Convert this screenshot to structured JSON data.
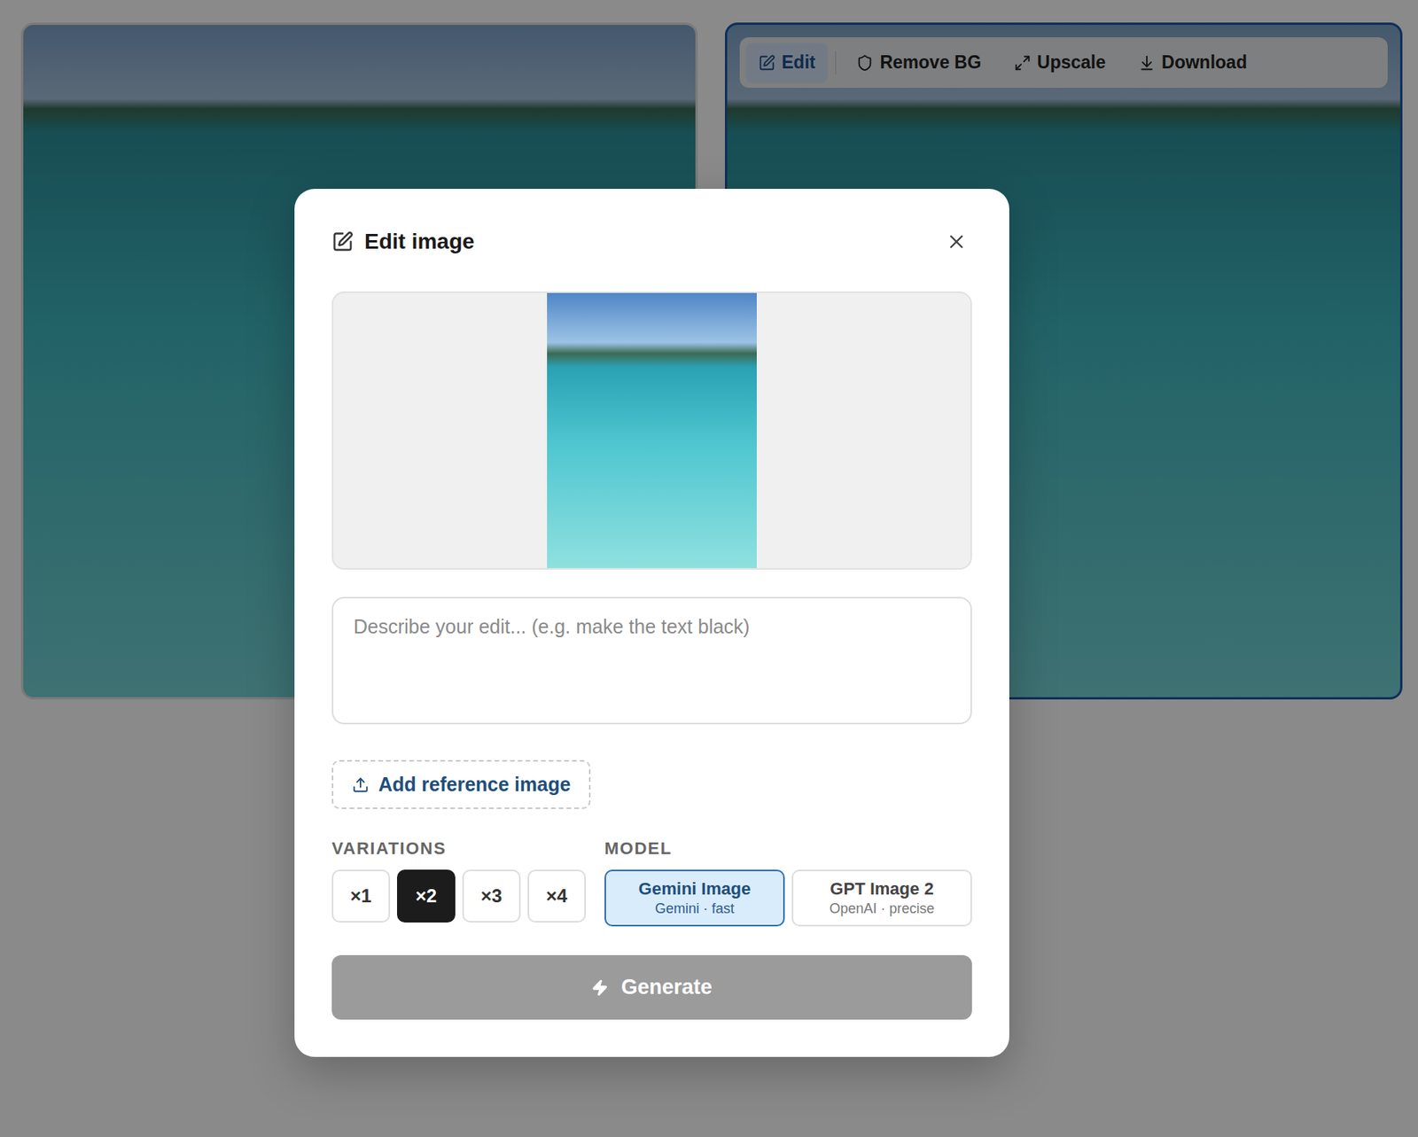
{
  "canvas": {
    "images": [
      {
        "selected": false
      },
      {
        "selected": true
      }
    ]
  },
  "toolbar": [
    {
      "label": "Edit",
      "selected": true
    },
    {
      "label": "Remove BG",
      "selected": false
    },
    {
      "label": "Upscale",
      "selected": false
    },
    {
      "label": "Download",
      "selected": false
    }
  ],
  "dialog": {
    "title": "Edit image",
    "prompt": {
      "placeholder": "Describe your edit... (e.g. make the text black)"
    },
    "reference_button": "Add reference image",
    "variations": {
      "label": "VARIATIONS",
      "options": [
        {
          "label": "×1",
          "selected": false
        },
        {
          "label": "×2",
          "selected": true
        },
        {
          "label": "×3",
          "selected": false
        },
        {
          "label": "×4",
          "selected": false
        }
      ]
    },
    "model": {
      "label": "MODEL",
      "options": [
        {
          "name": "Gemini Image",
          "detail": "Gemini · fast",
          "selected": true
        },
        {
          "name": "GPT Image 2",
          "detail": "OpenAI · precise",
          "selected": false
        }
      ]
    },
    "generate": {
      "label": "Generate",
      "disabled": true
    }
  }
}
